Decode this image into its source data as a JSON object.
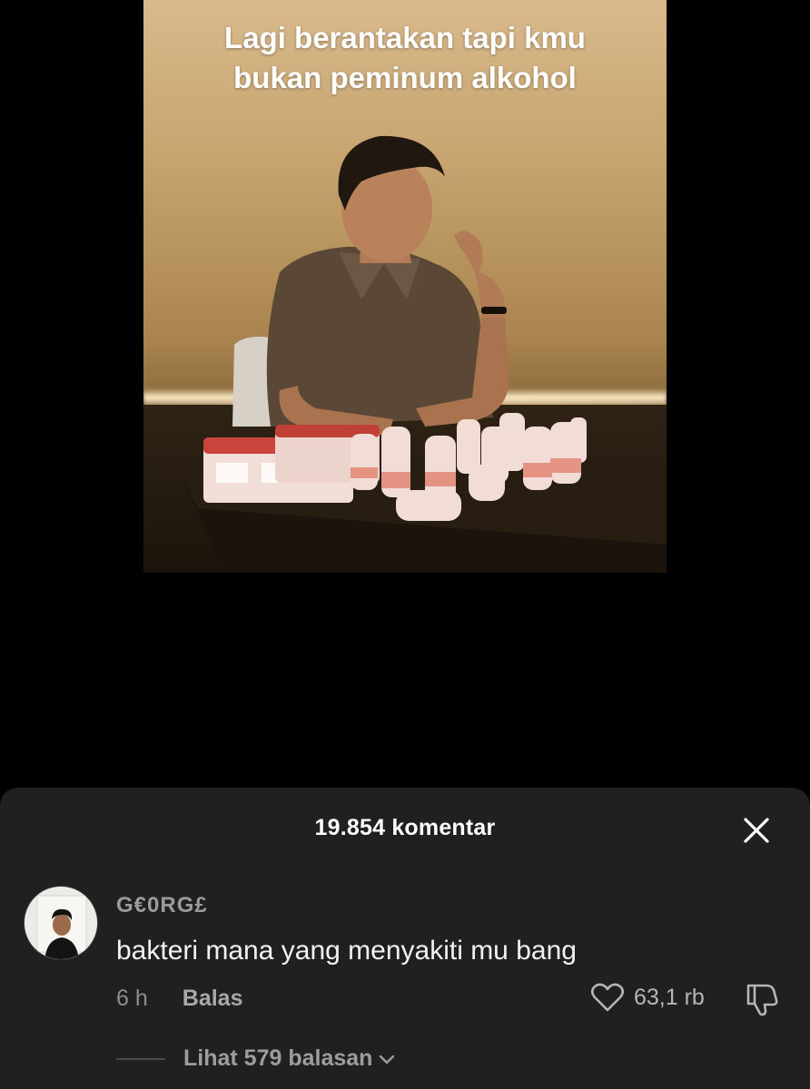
{
  "video": {
    "caption": "Lagi berantakan tapi kmu\nbukan peminum alkohol"
  },
  "comments_sheet": {
    "title": "19.854 komentar",
    "close_icon": "close-icon"
  },
  "comment": {
    "username": "G€0RG£",
    "text": "bakteri mana yang menyakiti mu bang",
    "time": "6 h",
    "reply_label": "Balas",
    "like_count": "63,1 rb",
    "like_icon": "heart-outline-icon",
    "dislike_icon": "thumbs-down-icon",
    "view_replies_label": "Lihat 579 balasan"
  },
  "colors": {
    "background": "#000000",
    "sheet": "#202020",
    "primary_text": "#ffffff",
    "secondary_text": "#9b9b9b"
  }
}
